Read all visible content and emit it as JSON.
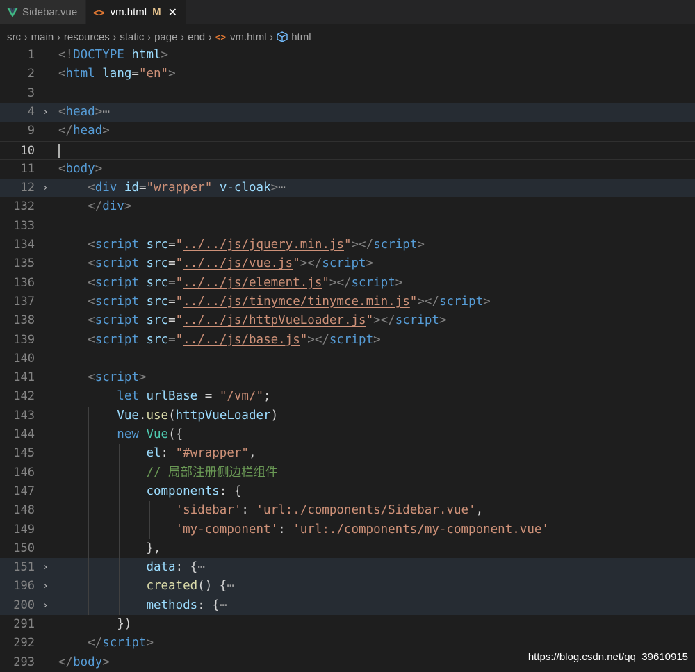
{
  "tabs": [
    {
      "label": "Sidebar.vue",
      "active": false,
      "icon": "vue-icon"
    },
    {
      "label": "vm.html",
      "active": true,
      "icon": "html-icon",
      "modified": "M",
      "close": "✕"
    }
  ],
  "breadcrumb": [
    "src",
    "main",
    "resources",
    "static",
    "page",
    "end",
    "vm.html",
    "html"
  ],
  "editor": {
    "current_line": "10",
    "lines": [
      {
        "n": "1",
        "t": [
          [
            "p",
            "<!"
          ],
          [
            "tag",
            "DOCTYPE"
          ],
          [
            "t",
            " "
          ],
          [
            "attr",
            "html"
          ],
          [
            "p",
            ">"
          ]
        ]
      },
      {
        "n": "2",
        "t": [
          [
            "p",
            "<"
          ],
          [
            "tag",
            "html"
          ],
          [
            "t",
            " "
          ],
          [
            "attr",
            "lang"
          ],
          [
            "t",
            "="
          ],
          [
            "str",
            "\"en\""
          ],
          [
            "p",
            ">"
          ]
        ]
      },
      {
        "n": "3",
        "t": []
      },
      {
        "n": "4",
        "fold": true,
        "hl": true,
        "t": [
          [
            "p",
            "<"
          ],
          [
            "tag",
            "head"
          ],
          [
            "p",
            ">"
          ],
          [
            "dots",
            "⋯"
          ]
        ]
      },
      {
        "n": "9",
        "t": [
          [
            "p",
            "</"
          ],
          [
            "tag",
            "head"
          ],
          [
            "p",
            ">"
          ]
        ]
      },
      {
        "n": "10",
        "cursor": true,
        "t": []
      },
      {
        "n": "11",
        "t": [
          [
            "p",
            "<"
          ],
          [
            "tag",
            "body"
          ],
          [
            "p",
            ">"
          ]
        ]
      },
      {
        "n": "12",
        "fold": true,
        "hl": true,
        "t": [
          [
            "t",
            "    "
          ],
          [
            "p",
            "<"
          ],
          [
            "tag",
            "div"
          ],
          [
            "t",
            " "
          ],
          [
            "attr",
            "id"
          ],
          [
            "t",
            "="
          ],
          [
            "str",
            "\"wrapper\""
          ],
          [
            "t",
            " "
          ],
          [
            "attr",
            "v-cloak"
          ],
          [
            "p",
            ">"
          ],
          [
            "dots",
            "⋯"
          ]
        ]
      },
      {
        "n": "132",
        "t": [
          [
            "t",
            "    "
          ],
          [
            "p",
            "</"
          ],
          [
            "tag",
            "div"
          ],
          [
            "p",
            ">"
          ]
        ]
      },
      {
        "n": "133",
        "t": []
      },
      {
        "n": "134",
        "t": [
          [
            "t",
            "    "
          ],
          [
            "p",
            "<"
          ],
          [
            "tag",
            "script"
          ],
          [
            "t",
            " "
          ],
          [
            "attr",
            "src"
          ],
          [
            "t",
            "="
          ],
          [
            "str",
            "\""
          ],
          [
            "link",
            "../../js/jquery.min.js"
          ],
          [
            "str",
            "\""
          ],
          [
            "p",
            "></"
          ],
          [
            "tag",
            "script"
          ],
          [
            "p",
            ">"
          ]
        ]
      },
      {
        "n": "135",
        "t": [
          [
            "t",
            "    "
          ],
          [
            "p",
            "<"
          ],
          [
            "tag",
            "script"
          ],
          [
            "t",
            " "
          ],
          [
            "attr",
            "src"
          ],
          [
            "t",
            "="
          ],
          [
            "str",
            "\""
          ],
          [
            "link",
            "../../js/vue.js"
          ],
          [
            "str",
            "\""
          ],
          [
            "p",
            "></"
          ],
          [
            "tag",
            "script"
          ],
          [
            "p",
            ">"
          ]
        ]
      },
      {
        "n": "136",
        "t": [
          [
            "t",
            "    "
          ],
          [
            "p",
            "<"
          ],
          [
            "tag",
            "script"
          ],
          [
            "t",
            " "
          ],
          [
            "attr",
            "src"
          ],
          [
            "t",
            "="
          ],
          [
            "str",
            "\""
          ],
          [
            "link",
            "../../js/element.js"
          ],
          [
            "str",
            "\""
          ],
          [
            "p",
            "></"
          ],
          [
            "tag",
            "script"
          ],
          [
            "p",
            ">"
          ]
        ]
      },
      {
        "n": "137",
        "t": [
          [
            "t",
            "    "
          ],
          [
            "p",
            "<"
          ],
          [
            "tag",
            "script"
          ],
          [
            "t",
            " "
          ],
          [
            "attr",
            "src"
          ],
          [
            "t",
            "="
          ],
          [
            "str",
            "\""
          ],
          [
            "link",
            "../../js/tinymce/tinymce.min.js"
          ],
          [
            "str",
            "\""
          ],
          [
            "p",
            "></"
          ],
          [
            "tag",
            "script"
          ],
          [
            "p",
            ">"
          ]
        ]
      },
      {
        "n": "138",
        "t": [
          [
            "t",
            "    "
          ],
          [
            "p",
            "<"
          ],
          [
            "tag",
            "script"
          ],
          [
            "t",
            " "
          ],
          [
            "attr",
            "src"
          ],
          [
            "t",
            "="
          ],
          [
            "str",
            "\""
          ],
          [
            "link",
            "../../js/httpVueLoader.js"
          ],
          [
            "str",
            "\""
          ],
          [
            "p",
            "></"
          ],
          [
            "tag",
            "script"
          ],
          [
            "p",
            ">"
          ]
        ]
      },
      {
        "n": "139",
        "t": [
          [
            "t",
            "    "
          ],
          [
            "p",
            "<"
          ],
          [
            "tag",
            "script"
          ],
          [
            "t",
            " "
          ],
          [
            "attr",
            "src"
          ],
          [
            "t",
            "="
          ],
          [
            "str",
            "\""
          ],
          [
            "link",
            "../../js/base.js"
          ],
          [
            "str",
            "\""
          ],
          [
            "p",
            "></"
          ],
          [
            "tag",
            "script"
          ],
          [
            "p",
            ">"
          ]
        ]
      },
      {
        "n": "140",
        "t": []
      },
      {
        "n": "141",
        "t": [
          [
            "t",
            "    "
          ],
          [
            "p",
            "<"
          ],
          [
            "tag",
            "script"
          ],
          [
            "p",
            ">"
          ]
        ]
      },
      {
        "n": "142",
        "t": [
          [
            "t",
            "        "
          ],
          [
            "kw",
            "let"
          ],
          [
            "t",
            " "
          ],
          [
            "var",
            "urlBase"
          ],
          [
            "t",
            " = "
          ],
          [
            "str",
            "\"/vm/\""
          ],
          [
            "t",
            ";"
          ]
        ]
      },
      {
        "n": "143",
        "t": [
          [
            "t",
            "        "
          ],
          [
            "var",
            "Vue"
          ],
          [
            "t",
            "."
          ],
          [
            "fn",
            "use"
          ],
          [
            "t",
            "("
          ],
          [
            "var",
            "httpVueLoader"
          ],
          [
            "t",
            ")"
          ]
        ]
      },
      {
        "n": "144",
        "t": [
          [
            "t",
            "        "
          ],
          [
            "kw",
            "new"
          ],
          [
            "t",
            " "
          ],
          [
            "cls",
            "Vue"
          ],
          [
            "t",
            "({"
          ]
        ]
      },
      {
        "n": "145",
        "t": [
          [
            "t",
            "            "
          ],
          [
            "var",
            "el"
          ],
          [
            "t",
            ": "
          ],
          [
            "str",
            "\"#wrapper\""
          ],
          [
            "t",
            ","
          ]
        ]
      },
      {
        "n": "146",
        "t": [
          [
            "t",
            "            "
          ],
          [
            "cm",
            "// 局部注册侧边栏组件"
          ]
        ]
      },
      {
        "n": "147",
        "t": [
          [
            "t",
            "            "
          ],
          [
            "var",
            "components"
          ],
          [
            "t",
            ": {"
          ]
        ]
      },
      {
        "n": "148",
        "t": [
          [
            "t",
            "                "
          ],
          [
            "str",
            "'sidebar'"
          ],
          [
            "t",
            ": "
          ],
          [
            "str",
            "'url:./components/Sidebar.vue'"
          ],
          [
            "t",
            ","
          ]
        ]
      },
      {
        "n": "149",
        "t": [
          [
            "t",
            "                "
          ],
          [
            "str",
            "'my-component'"
          ],
          [
            "t",
            ": "
          ],
          [
            "str",
            "'url:./components/my-component.vue'"
          ]
        ]
      },
      {
        "n": "150",
        "t": [
          [
            "t",
            "            },"
          ]
        ]
      },
      {
        "n": "151",
        "fold": true,
        "hl": true,
        "t": [
          [
            "t",
            "            "
          ],
          [
            "var",
            "data"
          ],
          [
            "t",
            ": {"
          ],
          [
            "dots",
            "⋯"
          ]
        ]
      },
      {
        "n": "196",
        "fold": true,
        "hl": true,
        "t": [
          [
            "t",
            "            "
          ],
          [
            "fn",
            "created"
          ],
          [
            "t",
            "() {"
          ],
          [
            "dots",
            "⋯"
          ]
        ]
      },
      {
        "n": "200",
        "fold": true,
        "hl": true,
        "t": [
          [
            "t",
            "            "
          ],
          [
            "var",
            "methods"
          ],
          [
            "t",
            ": {"
          ],
          [
            "dots",
            "⋯"
          ]
        ]
      },
      {
        "n": "291",
        "t": [
          [
            "t",
            "        })"
          ]
        ]
      },
      {
        "n": "292",
        "t": [
          [
            "t",
            "    "
          ],
          [
            "p",
            "</"
          ],
          [
            "tag",
            "script"
          ],
          [
            "p",
            ">"
          ]
        ]
      },
      {
        "n": "293",
        "t": [
          [
            "p",
            "</"
          ],
          [
            "tag",
            "body"
          ],
          [
            "p",
            ">"
          ]
        ]
      }
    ]
  },
  "watermark": "https://blog.csdn.net/qq_39610915",
  "colors": {
    "background": "#1e1e1e",
    "tag": "#569cd6",
    "attr": "#9cdcfe",
    "string": "#ce9178",
    "comment": "#6a9955",
    "function": "#dcdcaa"
  }
}
